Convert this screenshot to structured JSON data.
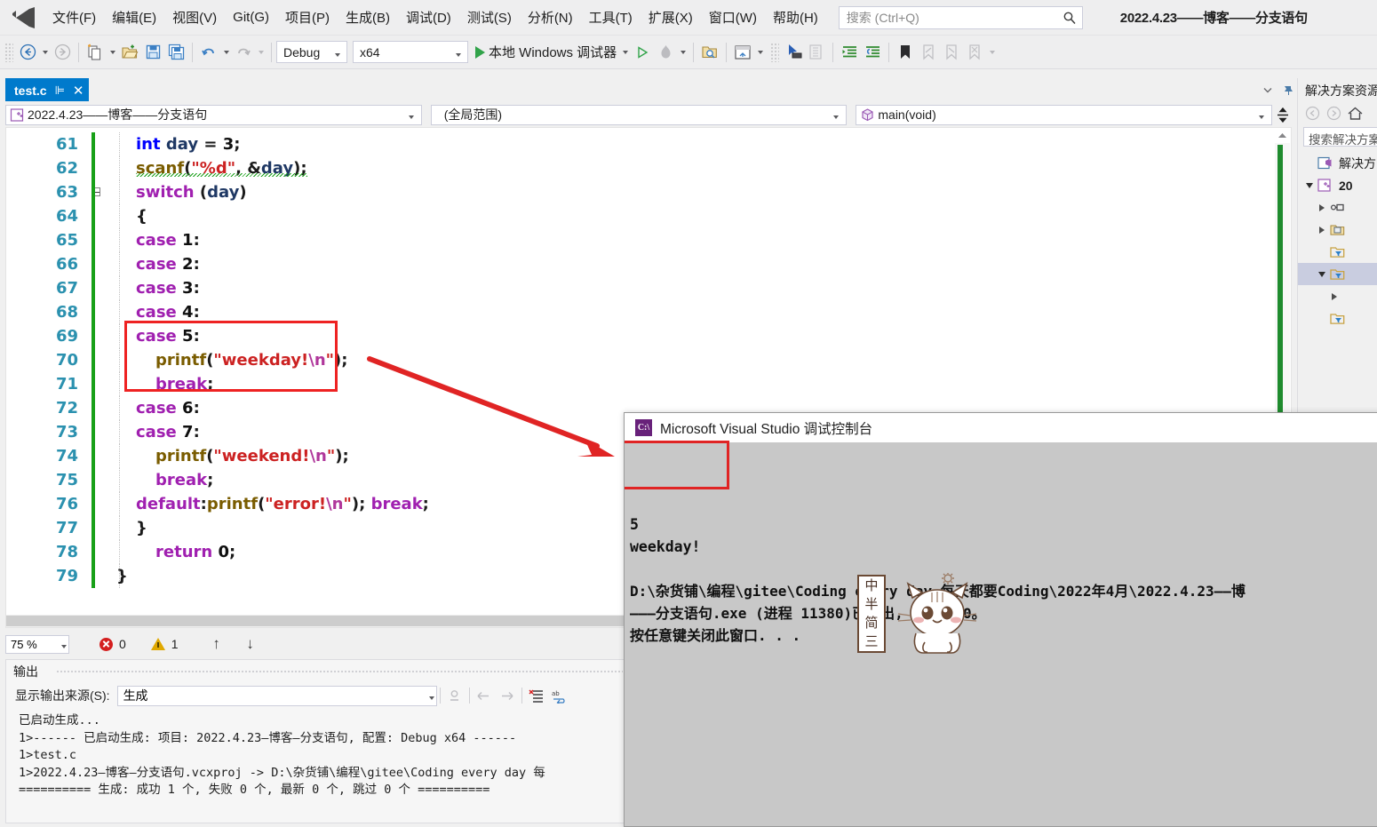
{
  "app": {
    "window_title": "2022.4.23——博客——分支语句",
    "logo_icon": "visual-studio-logo"
  },
  "menu": {
    "items": [
      {
        "label": "文件(F)"
      },
      {
        "label": "编辑(E)"
      },
      {
        "label": "视图(V)"
      },
      {
        "label": "Git(G)"
      },
      {
        "label": "项目(P)"
      },
      {
        "label": "生成(B)"
      },
      {
        "label": "调试(D)"
      },
      {
        "label": "测试(S)"
      },
      {
        "label": "分析(N)"
      },
      {
        "label": "工具(T)"
      },
      {
        "label": "扩展(X)"
      },
      {
        "label": "窗口(W)"
      },
      {
        "label": "帮助(H)"
      }
    ],
    "search_placeholder": "搜索 (Ctrl+Q)",
    "search_icon": "magnifier-icon"
  },
  "toolbar": {
    "back_icon": "navigate-back-icon",
    "forward_icon": "navigate-forward-icon",
    "new_item_icon": "new-item-icon",
    "open_icon": "open-file-icon",
    "save_icon": "save-icon",
    "save_all_icon": "save-all-icon",
    "undo_icon": "undo-icon",
    "redo_icon": "redo-icon",
    "configuration": "Debug",
    "platform": "x64",
    "start_debug_label": "本地 Windows 调试器",
    "start_icon": "play-triangle-icon",
    "start_no_debug_icon": "play-outline-icon",
    "hot_reload_icon": "hot-reload-icon",
    "search_in_files_icon": "find-in-files-icon",
    "window_layout_icon": "window-layout-icon",
    "pointer_select_icon": "pointer-select-icon",
    "compare_icon": "compare-icon",
    "indent_icon": "increase-indent-icon",
    "outdent_icon": "decrease-indent-icon",
    "bookmark_icon": "bookmark-icon",
    "prev_bookmark_icon": "previous-bookmark-icon",
    "next_bookmark_icon": "next-bookmark-icon",
    "clear_bookmarks_icon": "clear-bookmarks-icon",
    "overflow_icon": "toolbar-overflow-icon"
  },
  "document_tab": {
    "name": "test.c",
    "pin_icon": "pin-icon",
    "close_icon": "close-icon",
    "tabrow_dropdown_icon": "active-files-dropdown-icon",
    "tabrow_pin_icon": "pin-group-icon"
  },
  "navbar": {
    "project": "2022.4.23——博客——分支语句",
    "project_icon": "cpp-project-icon",
    "scope": "(全局范围)",
    "member": "main(void)",
    "member_icon": "method-cube-icon",
    "split_icon": "split-window-icon"
  },
  "editor": {
    "lines": [
      {
        "num": "61",
        "indent": 2,
        "fold": false,
        "tokens": [
          {
            "t": "int",
            "c": "kw-blue"
          },
          {
            "t": " ",
            "c": "punct"
          },
          {
            "t": "day",
            "c": "id-navy"
          },
          {
            "t": " = ",
            "c": "punct"
          },
          {
            "t": "3",
            "c": "num-dark"
          },
          {
            "t": ";",
            "c": "punct"
          }
        ]
      },
      {
        "num": "62",
        "indent": 2,
        "fold": false,
        "squiggle": true,
        "tokens": [
          {
            "t": "scanf",
            "c": "fn-brown"
          },
          {
            "t": "(",
            "c": "punct"
          },
          {
            "t": "\"%d\"",
            "c": "str-red"
          },
          {
            "t": ", ",
            "c": "punct"
          },
          {
            "t": "&",
            "c": "punct"
          },
          {
            "t": "day",
            "c": "id-navy"
          },
          {
            "t": ");",
            "c": "punct"
          }
        ]
      },
      {
        "num": "63",
        "indent": 2,
        "fold": true,
        "tokens": [
          {
            "t": "switch",
            "c": "kw-purple"
          },
          {
            "t": " (",
            "c": "punct"
          },
          {
            "t": "day",
            "c": "id-navy"
          },
          {
            "t": ")",
            "c": "punct"
          }
        ]
      },
      {
        "num": "64",
        "indent": 2,
        "fold": false,
        "tokens": [
          {
            "t": "{",
            "c": "punct"
          }
        ]
      },
      {
        "num": "65",
        "indent": 2,
        "fold": false,
        "tokens": [
          {
            "t": "case",
            "c": "kw-purple"
          },
          {
            "t": " ",
            "c": "punct"
          },
          {
            "t": "1",
            "c": "num-dark"
          },
          {
            "t": ":",
            "c": "punct"
          }
        ]
      },
      {
        "num": "66",
        "indent": 2,
        "fold": false,
        "tokens": [
          {
            "t": "case",
            "c": "kw-purple"
          },
          {
            "t": " ",
            "c": "punct"
          },
          {
            "t": "2",
            "c": "num-dark"
          },
          {
            "t": ":",
            "c": "punct"
          }
        ]
      },
      {
        "num": "67",
        "indent": 2,
        "fold": false,
        "tokens": [
          {
            "t": "case",
            "c": "kw-purple"
          },
          {
            "t": " ",
            "c": "punct"
          },
          {
            "t": "3",
            "c": "num-dark"
          },
          {
            "t": ":",
            "c": "punct"
          }
        ]
      },
      {
        "num": "68",
        "indent": 2,
        "fold": false,
        "tokens": [
          {
            "t": "case",
            "c": "kw-purple"
          },
          {
            "t": " ",
            "c": "punct"
          },
          {
            "t": "4",
            "c": "num-dark"
          },
          {
            "t": ":",
            "c": "punct"
          }
        ]
      },
      {
        "num": "69",
        "indent": 2,
        "fold": false,
        "tokens": [
          {
            "t": "case",
            "c": "kw-purple"
          },
          {
            "t": " ",
            "c": "punct"
          },
          {
            "t": "5",
            "c": "num-dark"
          },
          {
            "t": ":",
            "c": "punct"
          }
        ]
      },
      {
        "num": "70",
        "indent": 4,
        "fold": false,
        "tokens": [
          {
            "t": "printf",
            "c": "fn-brown"
          },
          {
            "t": "(",
            "c": "punct"
          },
          {
            "t": "\"weekday!",
            "c": "str-red"
          },
          {
            "t": "\\n",
            "c": "esc-pink"
          },
          {
            "t": "\"",
            "c": "str-red"
          },
          {
            "t": ");",
            "c": "punct"
          }
        ]
      },
      {
        "num": "71",
        "indent": 4,
        "fold": false,
        "tokens": [
          {
            "t": "break",
            "c": "kw-purple"
          },
          {
            "t": ";",
            "c": "punct"
          }
        ]
      },
      {
        "num": "72",
        "indent": 2,
        "fold": false,
        "tokens": [
          {
            "t": "case",
            "c": "kw-purple"
          },
          {
            "t": " ",
            "c": "punct"
          },
          {
            "t": "6",
            "c": "num-dark"
          },
          {
            "t": ":",
            "c": "punct"
          }
        ]
      },
      {
        "num": "73",
        "indent": 2,
        "fold": false,
        "tokens": [
          {
            "t": "case",
            "c": "kw-purple"
          },
          {
            "t": " ",
            "c": "punct"
          },
          {
            "t": "7",
            "c": "num-dark"
          },
          {
            "t": ":",
            "c": "punct"
          }
        ]
      },
      {
        "num": "74",
        "indent": 4,
        "fold": false,
        "tokens": [
          {
            "t": "printf",
            "c": "fn-brown"
          },
          {
            "t": "(",
            "c": "punct"
          },
          {
            "t": "\"weekend!",
            "c": "str-red"
          },
          {
            "t": "\\n",
            "c": "esc-pink"
          },
          {
            "t": "\"",
            "c": "str-red"
          },
          {
            "t": ");",
            "c": "punct"
          }
        ]
      },
      {
        "num": "75",
        "indent": 4,
        "fold": false,
        "tokens": [
          {
            "t": "break",
            "c": "kw-purple"
          },
          {
            "t": ";",
            "c": "punct"
          }
        ]
      },
      {
        "num": "76",
        "indent": 2,
        "fold": false,
        "tokens": [
          {
            "t": "default",
            "c": "kw-purple"
          },
          {
            "t": ":",
            "c": "punct"
          },
          {
            "t": "printf",
            "c": "fn-brown"
          },
          {
            "t": "(",
            "c": "punct"
          },
          {
            "t": "\"error!",
            "c": "str-red"
          },
          {
            "t": "\\n",
            "c": "esc-pink"
          },
          {
            "t": "\"",
            "c": "str-red"
          },
          {
            "t": "); ",
            "c": "punct"
          },
          {
            "t": "break",
            "c": "kw-purple"
          },
          {
            "t": ";",
            "c": "punct"
          }
        ]
      },
      {
        "num": "77",
        "indent": 2,
        "fold": false,
        "tokens": [
          {
            "t": "}",
            "c": "punct"
          }
        ]
      },
      {
        "num": "78",
        "indent": 4,
        "fold": false,
        "tokens": [
          {
            "t": "return",
            "c": "kw-purple"
          },
          {
            "t": " ",
            "c": "punct"
          },
          {
            "t": "0",
            "c": "num-dark"
          },
          {
            "t": ";",
            "c": "punct"
          }
        ]
      },
      {
        "num": "79",
        "indent": 0,
        "fold": false,
        "tokens": [
          {
            "t": "}",
            "c": "punct"
          }
        ]
      }
    ],
    "highlight_box_label": "case-5-printf-break-highlight"
  },
  "editor_status": {
    "zoom": "75 %",
    "error_count": "0",
    "warning_count": "1",
    "error_icon": "error-circle-icon",
    "warning_icon": "warning-triangle-icon",
    "prev_icon": "previous-issue-arrow-icon",
    "next_icon": "next-issue-arrow-icon"
  },
  "output_panel": {
    "title": "输出",
    "source_label": "显示输出来源(S):",
    "source_value": "生成",
    "toolbar_icons": [
      "find-message-icon",
      "go-to-previous-message-icon",
      "go-to-next-message-icon",
      "clear-all-icon",
      "toggle-word-wrap-icon"
    ],
    "lines": [
      "已启动生成...",
      "1>------ 已启动生成: 项目: 2022.4.23—博客—分支语句, 配置: Debug x64 ------",
      "1>test.c",
      "1>2022.4.23—博客—分支语句.vcxproj -> D:\\杂货铺\\编程\\gitee\\Coding every day 每",
      "========== 生成: 成功 1 个, 失败 0 个, 最新 0 个, 跳过 0 个 =========="
    ]
  },
  "solution_explorer": {
    "title": "解决方案资源",
    "back_icon": "nav-back-icon",
    "forward_icon": "nav-forward-icon",
    "home_icon": "home-icon",
    "search_placeholder": "搜索解决方案",
    "tree": [
      {
        "label": "解决方",
        "icon": "solution-icon",
        "expander": "none",
        "depth": 0,
        "bold": false,
        "selected": false
      },
      {
        "label": "20",
        "icon": "cpp-project-icon",
        "expander": "down",
        "depth": 0,
        "bold": true,
        "selected": false
      },
      {
        "label": "",
        "icon": "references-icon",
        "expander": "right",
        "depth": 1,
        "bold": false,
        "selected": false
      },
      {
        "label": "",
        "icon": "external-deps-icon",
        "expander": "right",
        "depth": 1,
        "bold": false,
        "selected": false
      },
      {
        "label": "",
        "icon": "filter-folder-icon",
        "expander": "none",
        "depth": 1,
        "bold": false,
        "selected": false
      },
      {
        "label": "",
        "icon": "filter-folder-icon",
        "expander": "down",
        "depth": 1,
        "bold": false,
        "selected": true
      },
      {
        "label": "",
        "icon": "none",
        "expander": "right",
        "depth": 2,
        "bold": false,
        "selected": false
      },
      {
        "label": "",
        "icon": "filter-folder-icon",
        "expander": "none",
        "depth": 1,
        "bold": false,
        "selected": false
      }
    ]
  },
  "console_window": {
    "title": "Microsoft Visual Studio 调试控制台",
    "icon_text": "C:\\",
    "icon_name": "console-app-icon",
    "lines": [
      "5",
      "weekday!",
      "",
      "D:\\杂货铺\\编程\\gitee\\Coding every day 每天都要Coding\\2022年4月\\2022.4.23——博",
      "———分支语句.exe (进程 11380)已退出, 代码为 0。",
      "按任意键关闭此窗口. . ."
    ],
    "highlight_box_label": "console-output-highlight"
  },
  "ime_widget": {
    "vertical_labels": [
      "中",
      "半",
      "简",
      "三"
    ],
    "mascot": "cat-mascot-icon"
  },
  "annotation": {
    "arrow": "red-arrow-pointing-to-console-output",
    "color": "#e02424"
  }
}
